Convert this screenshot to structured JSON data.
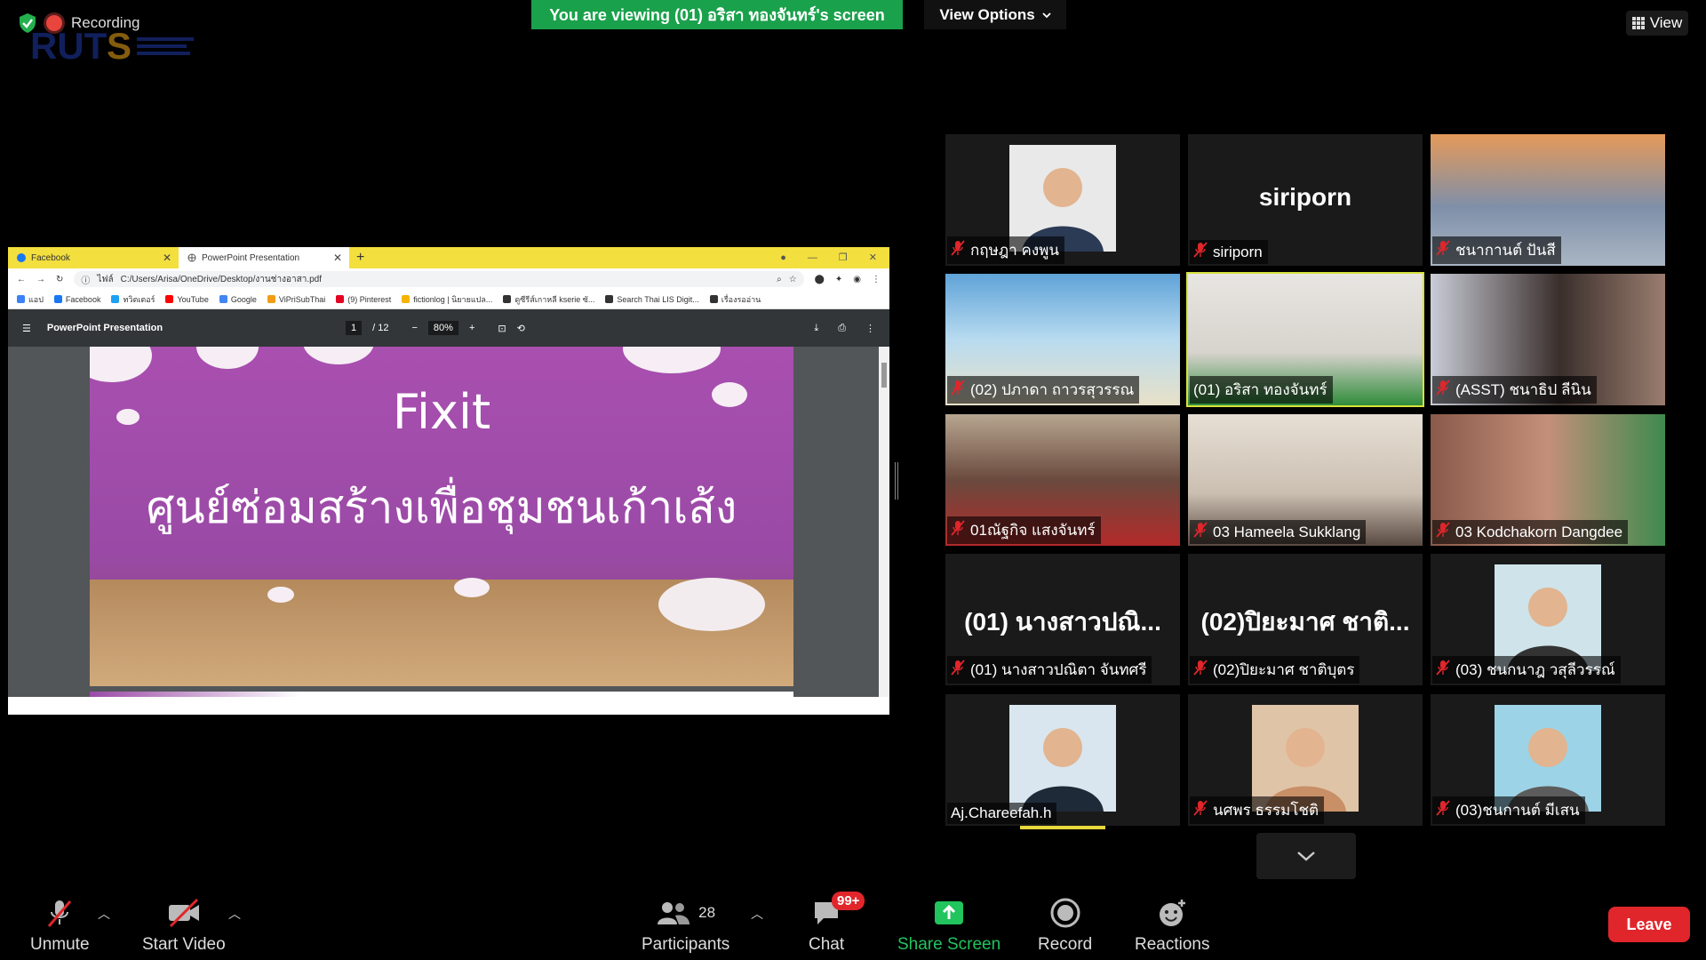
{
  "top": {
    "recording": "Recording",
    "viewing_banner": "You are viewing (01) อริสา ทองจันทร์'s screen",
    "view_options": "View Options",
    "view": "View"
  },
  "browser": {
    "tabs": [
      {
        "label": "Facebook"
      },
      {
        "label": "PowerPoint Presentation"
      }
    ],
    "url_prefix": "ไฟล์",
    "url": "C:/Users/Arisa/OneDrive/Desktop/งานช่างอาสา.pdf",
    "bookmarks": [
      "แอป",
      "Facebook",
      "ทวิตเตอร์",
      "YouTube",
      "Google",
      "ViPriSubThai",
      "(9) Pinterest",
      "fictionlog | นิยายแปล...",
      "ดูซีรีส์เกาหลี kserie ซั...",
      "Search Thai LIS Digit...",
      "เรื่องรออ่าน"
    ],
    "bookmark_colors": [
      "#3b82f6",
      "#1877f2",
      "#1da1f2",
      "#ff0000",
      "#4285f4",
      "#f39c12",
      "#e60023",
      "#f5b400",
      "#333333",
      "#333333",
      "#333333"
    ],
    "pdf_title": "PowerPoint Presentation",
    "page_current": "1",
    "page_total": "/ 12",
    "zoom": "80%",
    "slide_title": "Fixit",
    "slide_subtitle": "ศูนย์ซ่อมสร้างเพื่อชุมชนเก้าเส้ง"
  },
  "participants_grid": [
    {
      "name": "กฤษฎา คงพูน",
      "kind": "photo",
      "muted": true,
      "bg": "#e9e9e9",
      "fg": "#2b3a55"
    },
    {
      "name": "siriporn",
      "kind": "text",
      "big": "siriporn",
      "muted": true
    },
    {
      "name": "ชนากานต์ ปันสี",
      "kind": "video",
      "muted": true,
      "bg": "linear-gradient(180deg,#e59a5a,#7f8fa8 55%,#a9b6c4)"
    },
    {
      "name": "(02) ปภาดา ถาวรสุวรรณ",
      "kind": "video",
      "muted": true,
      "bg": "linear-gradient(180deg,#5fa3d8,#b8dbf0 50%,#e8e1c7)"
    },
    {
      "name": "(01) อริสา ทองจันทร์",
      "kind": "video",
      "muted": false,
      "speaking": true,
      "bg": "linear-gradient(180deg,#e8e6e2,#d7d3cd 60%,#2f8c3a)"
    },
    {
      "name": "(ASST) ชนาธิป ลีนิน",
      "kind": "video",
      "muted": true,
      "bg": "linear-gradient(90deg,#c9ccd6,#3a2f2c 55%,#9a7d6f)"
    },
    {
      "name": "01ณัฐกิจ แสงจันทร์",
      "kind": "video",
      "muted": true,
      "bg": "linear-gradient(180deg,#b7a690,#6a4a3e 50%,#b32a2a)"
    },
    {
      "name": "03 Hameela Sukklang",
      "kind": "video",
      "muted": true,
      "bg": "linear-gradient(180deg,#e7dfd5,#cbbfb1 60%,#5a4a42)"
    },
    {
      "name": "03 Kodchakorn Dangdee",
      "kind": "video",
      "muted": true,
      "bg": "linear-gradient(90deg,#8a5a4a,#c48f7a 50%,#3f8a4e)"
    },
    {
      "name": "(01) นางสาวปณิตา จันทศรี",
      "kind": "text",
      "big": "(01) นางสาวปณิ...",
      "muted": true
    },
    {
      "name": "(02)ปิยะมาศ ชาติบุตร",
      "kind": "text",
      "big": "(02)ปิยะมาศ ชาติ...",
      "muted": true
    },
    {
      "name": "(03) ชนกนาฎ วสุลีวรรณ์",
      "kind": "photo",
      "muted": true,
      "bg": "#cfe3ea",
      "fg": "#333333"
    },
    {
      "name": "Aj.Chareefah.h",
      "kind": "photo",
      "muted": false,
      "bg": "#d9e6ef",
      "fg": "#1f2a38"
    },
    {
      "name": "นศพร ธรรมโชติ",
      "kind": "photo",
      "muted": true,
      "bg": "#e0c4a8",
      "fg": "#c98f67"
    },
    {
      "name": "(03)ชนกานต์ มีเสน",
      "kind": "photo",
      "muted": true,
      "bg": "#9dd3e6",
      "fg": "#5c5c5c"
    }
  ],
  "toolbar": {
    "unmute": "Unmute",
    "start_video": "Start Video",
    "participants": "Participants",
    "participants_count": "28",
    "chat": "Chat",
    "chat_badge": "99+",
    "share_screen": "Share Screen",
    "record": "Record",
    "reactions": "Reactions",
    "leave": "Leave"
  }
}
